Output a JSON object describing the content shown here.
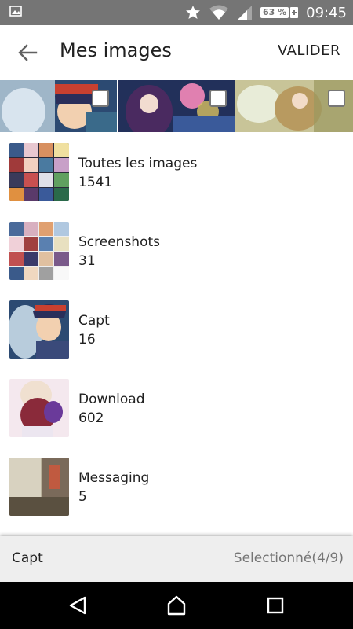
{
  "status_bar": {
    "time": "09:45",
    "battery": "63 %",
    "icons": [
      "image-notification-icon",
      "star-icon",
      "wifi-icon",
      "signal-icon",
      "battery-icon",
      "charging-icon"
    ]
  },
  "app_bar": {
    "title": "Mes images",
    "action": "VALIDER"
  },
  "selected_strip": {
    "thumbnails": [
      {
        "name": "anime-wolf-girl-image",
        "checked": false
      },
      {
        "name": "anime-purple-girl-image",
        "checked": false
      },
      {
        "name": "anime-golden-girl-image",
        "checked": false
      }
    ]
  },
  "albums": [
    {
      "name": "Toutes les images",
      "count": "1541"
    },
    {
      "name": "Screenshots",
      "count": "31"
    },
    {
      "name": "Capt",
      "count": "16"
    },
    {
      "name": "Download",
      "count": "602"
    },
    {
      "name": "Messaging",
      "count": "5"
    }
  ],
  "info_bar": {
    "folder": "Capt",
    "selection": "Selectionné(4/9)"
  },
  "nav_bar": {
    "buttons": [
      "back-icon",
      "home-icon",
      "recents-icon"
    ]
  },
  "colors": {
    "status_bar": "#757575",
    "info_bar": "#eeeeee",
    "nav_bar": "#000000"
  }
}
